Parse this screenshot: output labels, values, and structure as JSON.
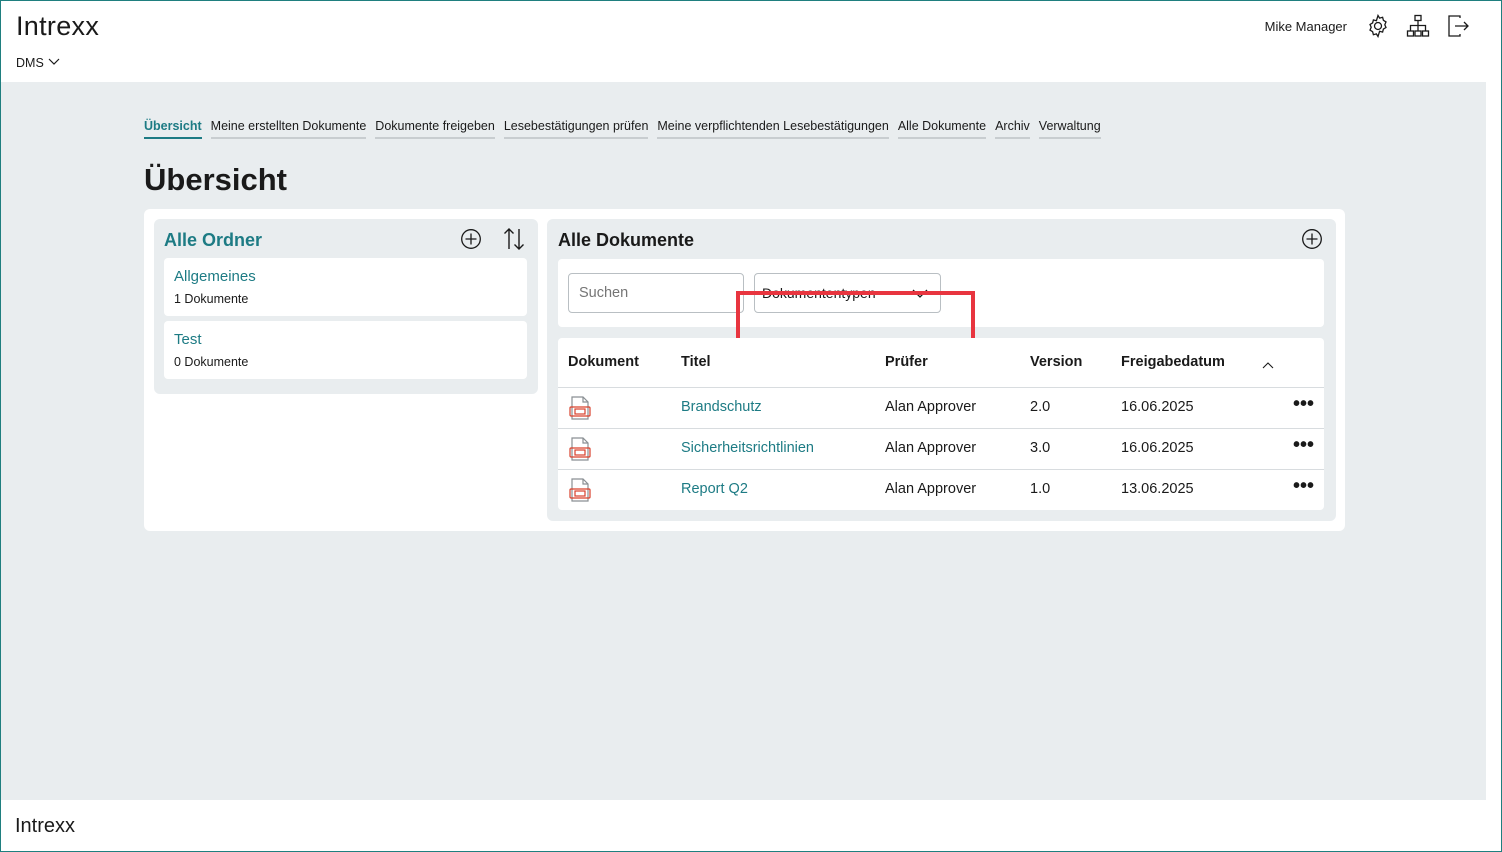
{
  "header": {
    "logo": "Intrexx",
    "app_name": "DMS",
    "user_name": "Mike Manager",
    "icons": [
      "gear-icon",
      "sitemap-icon",
      "logout-icon"
    ]
  },
  "tabs": [
    {
      "label": "Übersicht",
      "active": true
    },
    {
      "label": "Meine erstellten Dokumente"
    },
    {
      "label": "Dokumente freigeben"
    },
    {
      "label": "Lesebestätigungen prüfen"
    },
    {
      "label": "Meine verpflichtenden Lesebestätigungen"
    },
    {
      "label": "Alle Dokumente"
    },
    {
      "label": "Archiv"
    },
    {
      "label": "Verwaltung"
    }
  ],
  "page_title": "Übersicht",
  "folders": {
    "title": "Alle Ordner",
    "items": [
      {
        "name": "Allgemeines",
        "count": "1 Dokumente"
      },
      {
        "name": "Test",
        "count": "0 Dokumente"
      }
    ]
  },
  "documents": {
    "title": "Alle Dokumente",
    "search_placeholder": "Suchen",
    "type_filter": "Dokumententypen",
    "columns": [
      "Dokument",
      "Titel",
      "Prüfer",
      "Version",
      "Freigabedatum"
    ],
    "rows": [
      {
        "title": "Brandschutz",
        "reviewer": "Alan Approver",
        "version": "2.0",
        "date": "16.06.2025"
      },
      {
        "title": "Sicherheitsrichtlinien",
        "reviewer": "Alan Approver",
        "version": "3.0",
        "date": "16.06.2025"
      },
      {
        "title": "Report Q2",
        "reviewer": "Alan Approver",
        "version": "1.0",
        "date": "13.06.2025"
      }
    ],
    "more_label": "•••"
  },
  "footer": {
    "logo": "Intrexx"
  },
  "colors": {
    "accent": "#1d7b84",
    "highlight": "#e8353f",
    "background": "#e9edef"
  }
}
